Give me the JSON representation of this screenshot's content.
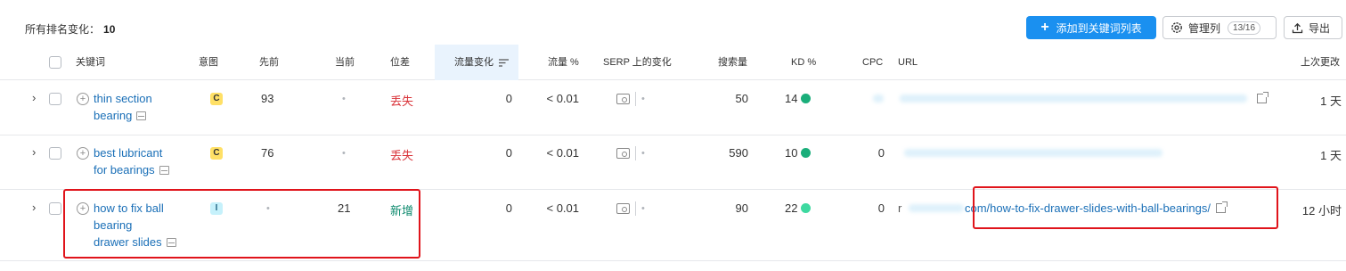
{
  "summary": {
    "label": "所有排名变化：",
    "count": "10"
  },
  "toolbar": {
    "add_label": "添加到关键词列表",
    "manage_label": "管理列",
    "manage_count": "13/16",
    "export_label": "导出"
  },
  "columns": {
    "keyword": "关键词",
    "intent": "意图",
    "previous": "先前",
    "current": "当前",
    "diff": "位差",
    "traffic_change": "流量变化",
    "traffic_pct": "流量 %",
    "serp_change": "SERP 上的变化",
    "volume": "搜索量",
    "kd": "KD %",
    "cpc": "CPC",
    "url": "URL",
    "updated": "上次更改"
  },
  "rows": [
    {
      "keyword_line1": "thin section",
      "keyword_line2": "bearing",
      "keyword_line3": "",
      "intent": "C",
      "previous": "93",
      "current": "•",
      "diff": "丢失",
      "traffic_change": "0",
      "traffic_pct": "< 0.01",
      "serp_dot": "•",
      "volume": "50",
      "kd": "14",
      "cpc": "",
      "url": "",
      "updated": "1 天"
    },
    {
      "keyword_line1": "best lubricant",
      "keyword_line2": "for bearings",
      "keyword_line3": "",
      "intent": "C",
      "previous": "76",
      "current": "•",
      "diff": "丢失",
      "traffic_change": "0",
      "traffic_pct": "< 0.01",
      "serp_dot": "•",
      "volume": "590",
      "kd": "10",
      "cpc": "0",
      "url": "",
      "updated": "1 天"
    },
    {
      "keyword_line1": "how to fix ball",
      "keyword_line2": "bearing",
      "keyword_line3": "drawer slides",
      "intent": "I",
      "previous": "•",
      "current": "21",
      "diff": "新增",
      "traffic_change": "0",
      "traffic_pct": "< 0.01",
      "serp_dot": "•",
      "volume": "90",
      "kd": "22",
      "cpc": "0",
      "url_prefix": "r",
      "url": "com/how-to-fix-drawer-slides-with-ball-bearings/",
      "updated": "12 小时"
    }
  ],
  "colors": {
    "accent": "#1a90f0",
    "lost": "#d9343a",
    "new": "#0e8a6e",
    "kd_green": "#1aae7a",
    "kd_light_green": "#3ed9a0",
    "highlight_box": "#e0141b"
  },
  "icons": [
    "plus-icon",
    "gear-icon",
    "upload-icon",
    "sort-icon",
    "chevron-right-icon",
    "add-circle-icon",
    "doc-icon",
    "serp-icon",
    "external-link-icon"
  ]
}
